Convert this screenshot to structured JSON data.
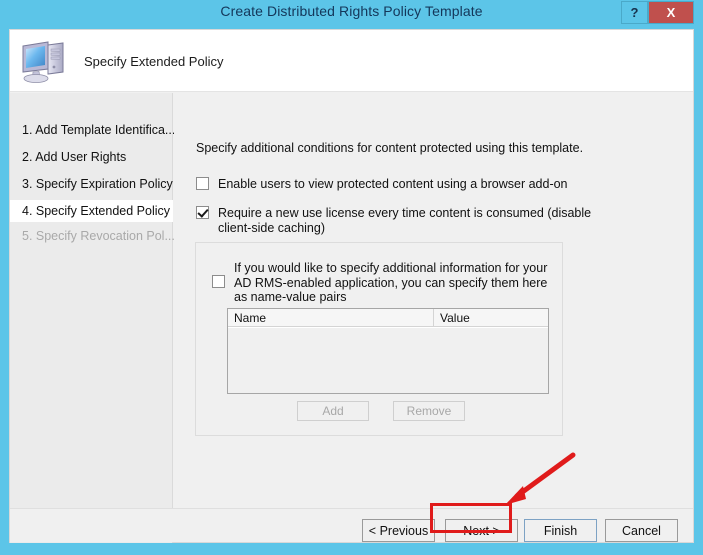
{
  "window": {
    "title": "Create Distributed Rights Policy Template",
    "help_button": "?",
    "close_button": "X",
    "frame_color": "#5cc5e8",
    "title_color": "#14375a",
    "close_color": "#c0504d"
  },
  "header": {
    "icon": "computer-icon",
    "title": "Specify Extended Policy"
  },
  "sidebar": {
    "items": [
      {
        "label": "1. Add Template Identifica...",
        "state": "normal"
      },
      {
        "label": "2. Add User Rights",
        "state": "normal"
      },
      {
        "label": "3. Specify Expiration Policy",
        "state": "normal"
      },
      {
        "label": "4. Specify Extended Policy",
        "state": "selected"
      },
      {
        "label": "5. Specify Revocation Pol...",
        "state": "disabled"
      }
    ]
  },
  "main": {
    "intro": "Specify additional conditions for content protected using this template.",
    "checkboxes": [
      {
        "label": "Enable users to view protected content using a browser add-on",
        "checked": false
      },
      {
        "label": "Require a new use license every time content is consumed (disable client-side caching)",
        "checked": true
      }
    ],
    "groupbox": {
      "checkbox": {
        "label": "If you would like to specify additional information for your AD RMS-enabled application, you can specify them here as name-value pairs",
        "checked": false
      },
      "table": {
        "columns": [
          "Name",
          "Value"
        ],
        "rows": []
      },
      "buttons": [
        {
          "label": "Add",
          "enabled": false
        },
        {
          "label": "Remove",
          "enabled": false
        }
      ]
    }
  },
  "footer": {
    "buttons": [
      {
        "label": "< Previous",
        "state": "normal"
      },
      {
        "label": "Next >",
        "state": "highlighted"
      },
      {
        "label": "Finish",
        "state": "focused"
      },
      {
        "label": "Cancel",
        "state": "normal"
      }
    ]
  },
  "annotation": {
    "color": "#e01b1b",
    "target": "Next >",
    "shape": "arrow-and-box"
  }
}
